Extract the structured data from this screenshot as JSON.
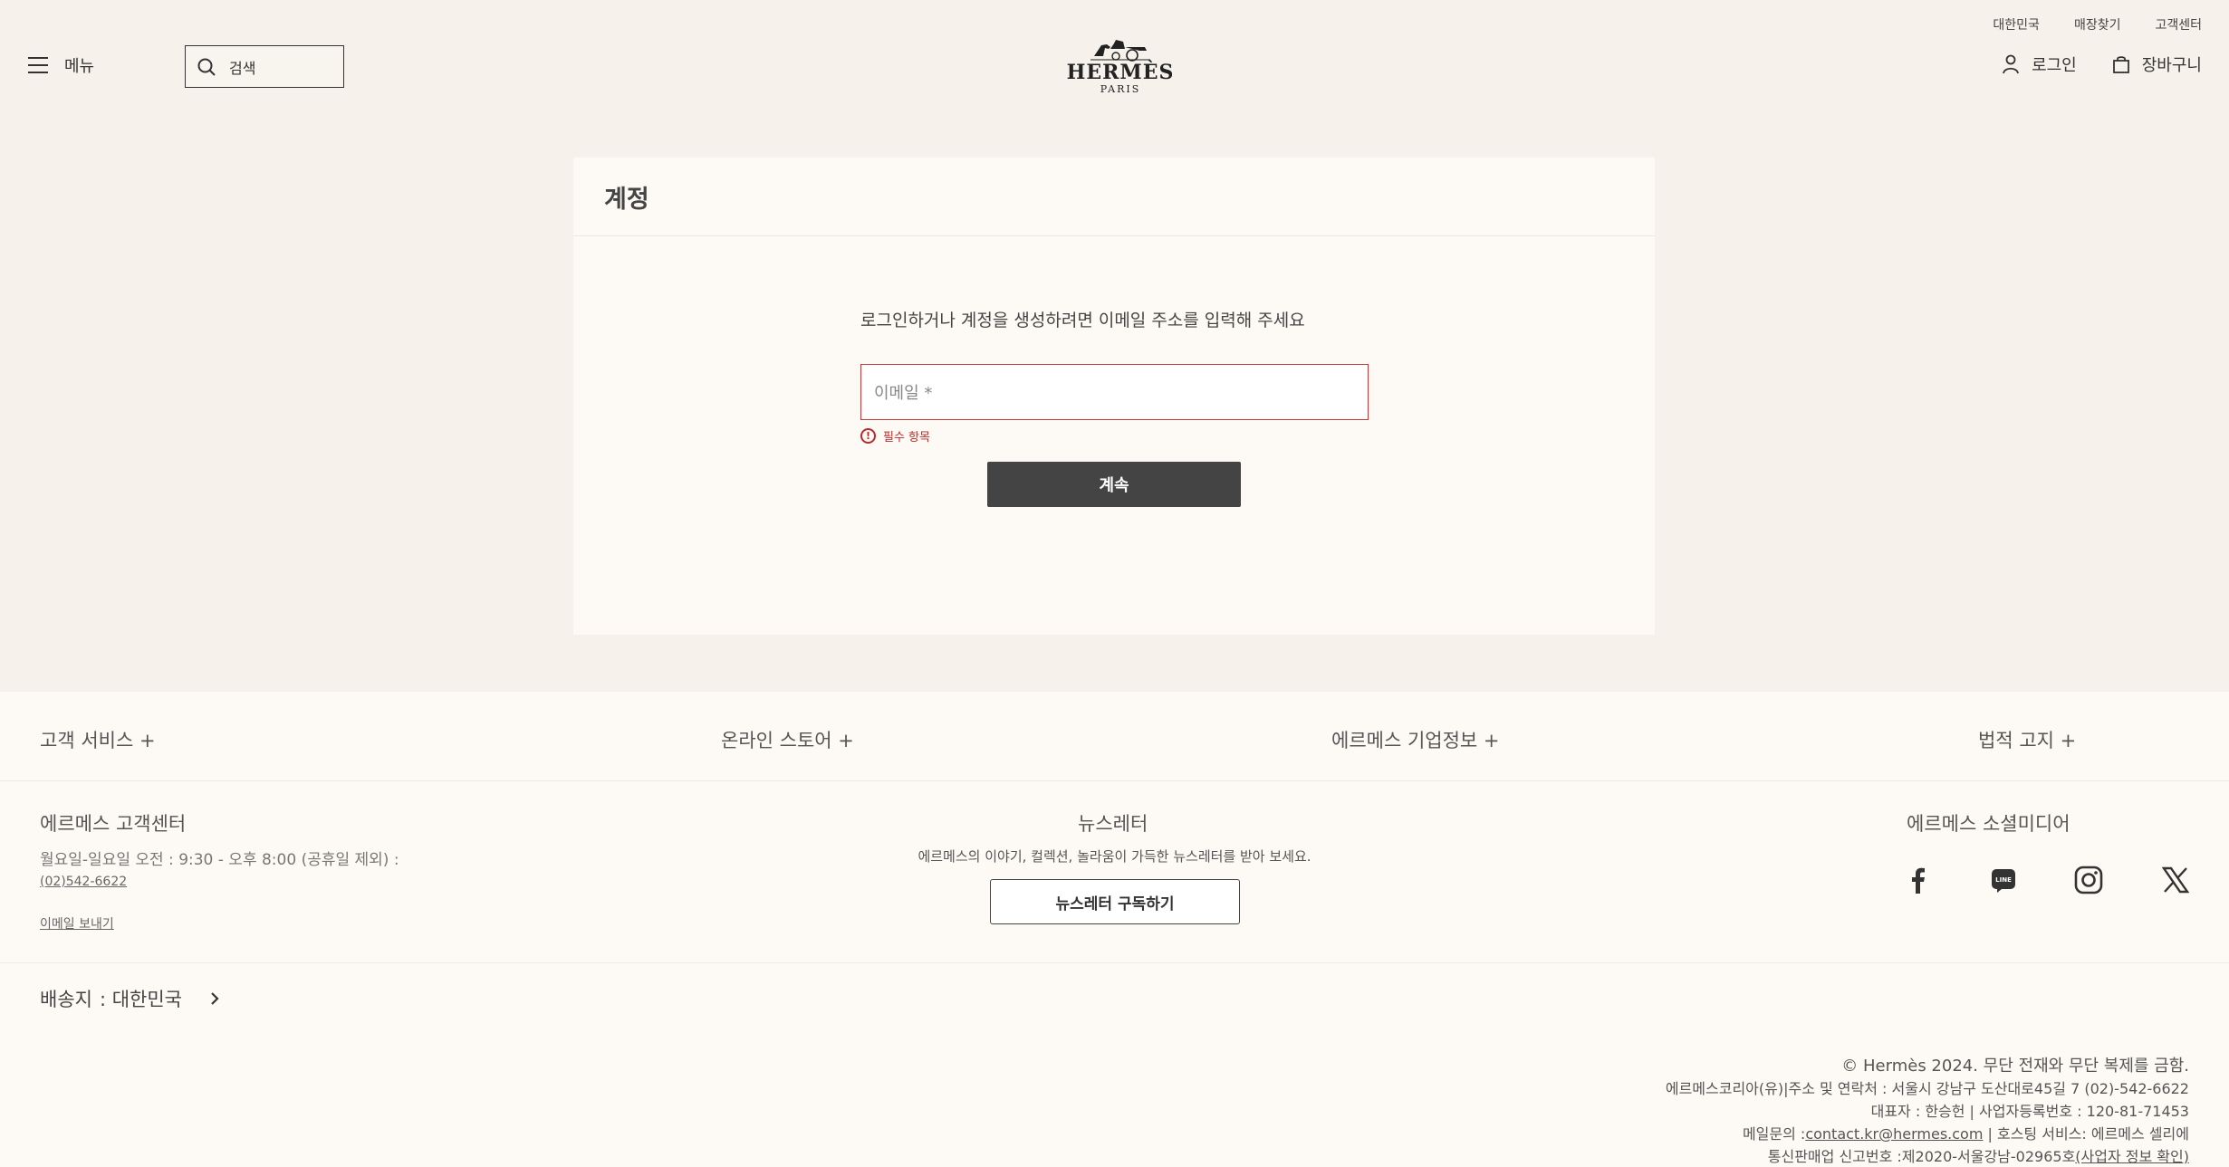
{
  "header": {
    "top_links": [
      "대한민국",
      "매장찾기",
      "고객센터"
    ],
    "menu_label": "메뉴",
    "search_placeholder": "검색",
    "logo": {
      "brand": "HERMÈS",
      "city": "PARIS"
    },
    "login_label": "로그인",
    "cart_label": "장바구니"
  },
  "account": {
    "title": "계정",
    "prompt": "로그인하거나 계정을 생성하려면 이메일 주소를 입력해 주세요",
    "email_placeholder": "이메일 *",
    "error_text": "필수 항목",
    "continue_label": "계속"
  },
  "footer": {
    "accordion": [
      "고객 서비스 +",
      "온라인 스토어 +",
      "에르메스 기업정보 +",
      "법적 고지 +"
    ],
    "customer_center": {
      "title": "에르메스 고객센터",
      "hours": "월요일-일요일 오전 : 9:30 - 오후 8:00 (공휴일 제외) :",
      "phone": "(02)542-6622",
      "email_link": "이메일 보내기"
    },
    "newsletter": {
      "title": "뉴스레터",
      "desc": "에르메스의 이야기, 컬렉션, 놀라움이 가득한 뉴스레터를 받아 보세요.",
      "button": "뉴스레터 구독하기"
    },
    "social": {
      "title": "에르메스 소셜미디어",
      "icons": [
        "facebook-icon",
        "line-icon",
        "instagram-icon",
        "x-icon"
      ]
    },
    "shipping": {
      "label": "배송지",
      "value": ": 대한민국"
    },
    "legal": {
      "copyright": "© Hermès 2024. 무단 전재와 무단 복제를 금함.",
      "line1": "에르메스코리아(유)|주소 및 연락처 : 서울시 강남구 도산대로45길 7 (02)-542-6622",
      "line2": "대표자 : 한승헌 | 사업자등록번호 : 120-81-71453",
      "line3_prefix": "메일문의 :",
      "line3_email": "contact.kr@hermes.com",
      "line3_suffix": " | 호스팅 서비스: 에르메스 셀리에",
      "line4_prefix": "통신판매업 신고번호 :제2020-서울강남-02965호",
      "line4_link": "(사업자 정보 확인)"
    }
  },
  "colors": {
    "page_bg": "#f6f1eb",
    "card_bg": "#fdfaf5",
    "error": "#c43a3a",
    "button_dark": "#444444"
  }
}
